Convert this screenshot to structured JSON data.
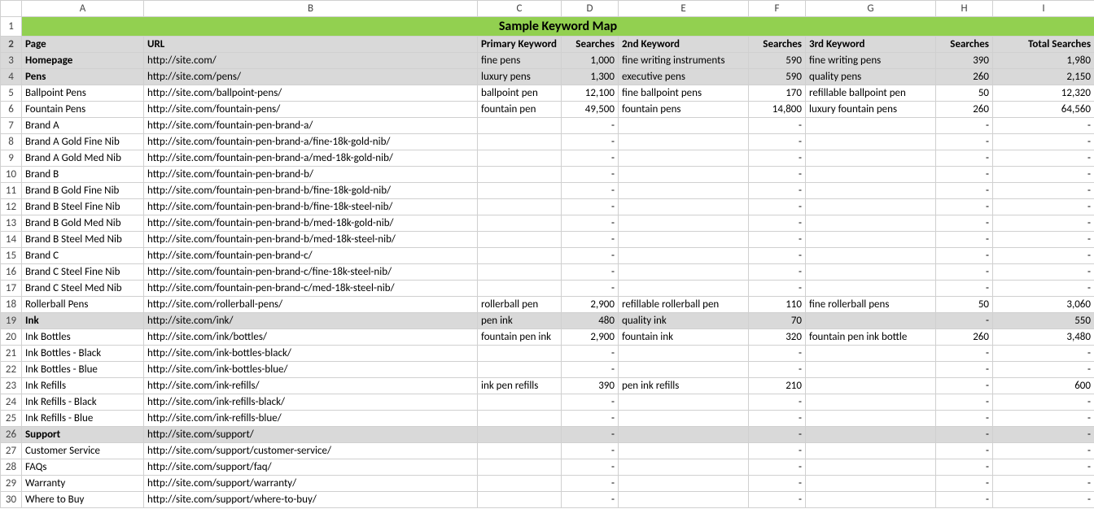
{
  "col_letters": [
    "A",
    "B",
    "C",
    "D",
    "E",
    "F",
    "G",
    "H",
    "I"
  ],
  "title": "Sample Keyword Map",
  "headers": {
    "page": "Page",
    "url": "URL",
    "primary_kw": "Primary Keyword",
    "searches1": "Searches",
    "kw2": "2nd Keyword",
    "searches2": "Searches",
    "kw3": "3rd Keyword",
    "searches3": "Searches",
    "total": "Total Searches"
  },
  "rows": [
    {
      "n": 3,
      "section": true,
      "page": "Homepage",
      "url": "http://site.com/",
      "primary_kw": "fine pens",
      "s1": "1,000",
      "kw2": "fine writing instruments",
      "s2": "590",
      "kw3": "fine writing pens",
      "s3": "390",
      "total": "1,980"
    },
    {
      "n": 4,
      "section": true,
      "page": "Pens",
      "url": "http://site.com/pens/",
      "primary_kw": "luxury pens",
      "s1": "1,300",
      "kw2": "executive pens",
      "s2": "590",
      "kw3": "quality pens",
      "s3": "260",
      "total": "2,150"
    },
    {
      "n": 5,
      "page": "Ballpoint Pens",
      "url": "http://site.com/ballpoint-pens/",
      "primary_kw": "ballpoint pen",
      "s1": "12,100",
      "kw2": "fine ballpoint pens",
      "s2": "170",
      "kw3": "refillable ballpoint pen",
      "s3": "50",
      "total": "12,320"
    },
    {
      "n": 6,
      "page": "Fountain Pens",
      "url": "http://site.com/fountain-pens/",
      "primary_kw": "fountain pen",
      "s1": "49,500",
      "kw2": "fountain pens",
      "s2": "14,800",
      "kw3": "luxury fountain pens",
      "s3": "260",
      "total": "64,560"
    },
    {
      "n": 7,
      "page": "Brand A",
      "url": "http://site.com/fountain-pen-brand-a/",
      "primary_kw": "",
      "s1": "-",
      "kw2": "",
      "s2": "-",
      "kw3": "",
      "s3": "-",
      "total": "-"
    },
    {
      "n": 8,
      "page": "Brand A Gold Fine Nib",
      "url": "http://site.com/fountain-pen-brand-a/fine-18k-gold-nib/",
      "primary_kw": "",
      "s1": "-",
      "kw2": "",
      "s2": "-",
      "kw3": "",
      "s3": "-",
      "total": "-"
    },
    {
      "n": 9,
      "page": "Brand A Gold Med Nib",
      "url": "http://site.com/fountain-pen-brand-a/med-18k-gold-nib/",
      "primary_kw": "",
      "s1": "-",
      "kw2": "",
      "s2": "-",
      "kw3": "",
      "s3": "-",
      "total": "-"
    },
    {
      "n": 10,
      "page": "Brand B",
      "url": "http://site.com/fountain-pen-brand-b/",
      "primary_kw": "",
      "s1": "-",
      "kw2": "",
      "s2": "-",
      "kw3": "",
      "s3": "-",
      "total": "-"
    },
    {
      "n": 11,
      "page": "Brand B Gold Fine Nib",
      "url": "http://site.com/fountain-pen-brand-b/fine-18k-gold-nib/",
      "primary_kw": "",
      "s1": "-",
      "kw2": "",
      "s2": "-",
      "kw3": "",
      "s3": "-",
      "total": "-"
    },
    {
      "n": 12,
      "page": "Brand B Steel Fine Nib",
      "url": "http://site.com/fountain-pen-brand-b/fine-18k-steel-nib/",
      "primary_kw": "",
      "s1": "-",
      "kw2": "",
      "s2": "-",
      "kw3": "",
      "s3": "-",
      "total": "-"
    },
    {
      "n": 13,
      "page": "Brand B Gold Med Nib",
      "url": "http://site.com/fountain-pen-brand-b/med-18k-gold-nib/",
      "primary_kw": "",
      "s1": "-",
      "kw2": "",
      "s2": "-",
      "kw3": "",
      "s3": "-",
      "total": "-"
    },
    {
      "n": 14,
      "page": "Brand B Steel Med Nib",
      "url": "http://site.com/fountain-pen-brand-b/med-18k-steel-nib/",
      "primary_kw": "",
      "s1": "-",
      "kw2": "",
      "s2": "-",
      "kw3": "",
      "s3": "-",
      "total": "-"
    },
    {
      "n": 15,
      "page": "Brand C",
      "url": "http://site.com/fountain-pen-brand-c/",
      "primary_kw": "",
      "s1": "-",
      "kw2": "",
      "s2": "-",
      "kw3": "",
      "s3": "-",
      "total": "-"
    },
    {
      "n": 16,
      "page": "Brand C Steel Fine Nib",
      "url": "http://site.com/fountain-pen-brand-c/fine-18k-steel-nib/",
      "primary_kw": "",
      "s1": "-",
      "kw2": "",
      "s2": "-",
      "kw3": "",
      "s3": "-",
      "total": "-"
    },
    {
      "n": 17,
      "page": "Brand C Steel Med Nib",
      "url": "http://site.com/fountain-pen-brand-c/med-18k-steel-nib/",
      "primary_kw": "",
      "s1": "-",
      "kw2": "",
      "s2": "-",
      "kw3": "",
      "s3": "-",
      "total": "-"
    },
    {
      "n": 18,
      "page": "Rollerball Pens",
      "url": "http://site.com/rollerball-pens/",
      "primary_kw": "rollerball pen",
      "s1": "2,900",
      "kw2": "refillable rollerball pen",
      "s2": "110",
      "kw3": "fine rollerball pens",
      "s3": "50",
      "total": "3,060"
    },
    {
      "n": 19,
      "section": true,
      "page": "Ink",
      "url": "http://site.com/ink/",
      "primary_kw": "pen ink",
      "s1": "480",
      "kw2": "quality ink",
      "s2": "70",
      "kw3": "",
      "s3": "-",
      "total": "550"
    },
    {
      "n": 20,
      "page": "Ink Bottles",
      "url": "http://site.com/ink/bottles/",
      "primary_kw": "fountain pen ink",
      "s1": "2,900",
      "kw2": "fountain ink",
      "s2": "320",
      "kw3": "fountain pen ink bottle",
      "s3": "260",
      "total": "3,480"
    },
    {
      "n": 21,
      "page": "Ink Bottles - Black",
      "url": "http://site.com/ink-bottles-black/",
      "primary_kw": "",
      "s1": "-",
      "kw2": "",
      "s2": "-",
      "kw3": "",
      "s3": "-",
      "total": "-"
    },
    {
      "n": 22,
      "page": "Ink Bottles - Blue",
      "url": "http://site.com/ink-bottles-blue/",
      "primary_kw": "",
      "s1": "-",
      "kw2": "",
      "s2": "-",
      "kw3": "",
      "s3": "-",
      "total": "-"
    },
    {
      "n": 23,
      "page": "Ink Refills",
      "url": "http://site.com/ink-refills/",
      "primary_kw": "ink pen refills",
      "s1": "390",
      "kw2": "pen ink refills",
      "s2": "210",
      "kw3": "",
      "s3": "-",
      "total": "600"
    },
    {
      "n": 24,
      "page": "Ink Refills - Black",
      "url": "http://site.com/ink-refills-black/",
      "primary_kw": "",
      "s1": "-",
      "kw2": "",
      "s2": "-",
      "kw3": "",
      "s3": "-",
      "total": "-"
    },
    {
      "n": 25,
      "page": "Ink Refills - Blue",
      "url": "http://site.com/ink-refills-blue/",
      "primary_kw": "",
      "s1": "-",
      "kw2": "",
      "s2": "-",
      "kw3": "",
      "s3": "-",
      "total": "-"
    },
    {
      "n": 26,
      "section": true,
      "page": "Support",
      "url": "http://site.com/support/",
      "primary_kw": "",
      "s1": "-",
      "kw2": "",
      "s2": "-",
      "kw3": "",
      "s3": "-",
      "total": "-"
    },
    {
      "n": 27,
      "page": "Customer Service",
      "url": "http://site.com/support/customer-service/",
      "primary_kw": "",
      "s1": "-",
      "kw2": "",
      "s2": "-",
      "kw3": "",
      "s3": "-",
      "total": "-"
    },
    {
      "n": 28,
      "page": "FAQs",
      "url": "http://site.com/support/faq/",
      "primary_kw": "",
      "s1": "-",
      "kw2": "",
      "s2": "-",
      "kw3": "",
      "s3": "-",
      "total": "-"
    },
    {
      "n": 29,
      "page": "Warranty",
      "url": "http://site.com/support/warranty/",
      "primary_kw": "",
      "s1": "-",
      "kw2": "",
      "s2": "-",
      "kw3": "",
      "s3": "-",
      "total": "-"
    },
    {
      "n": 30,
      "page": "Where to Buy",
      "url": "http://site.com/support/where-to-buy/",
      "primary_kw": "",
      "s1": "-",
      "kw2": "",
      "s2": "-",
      "kw3": "",
      "s3": "-",
      "total": "-"
    }
  ]
}
